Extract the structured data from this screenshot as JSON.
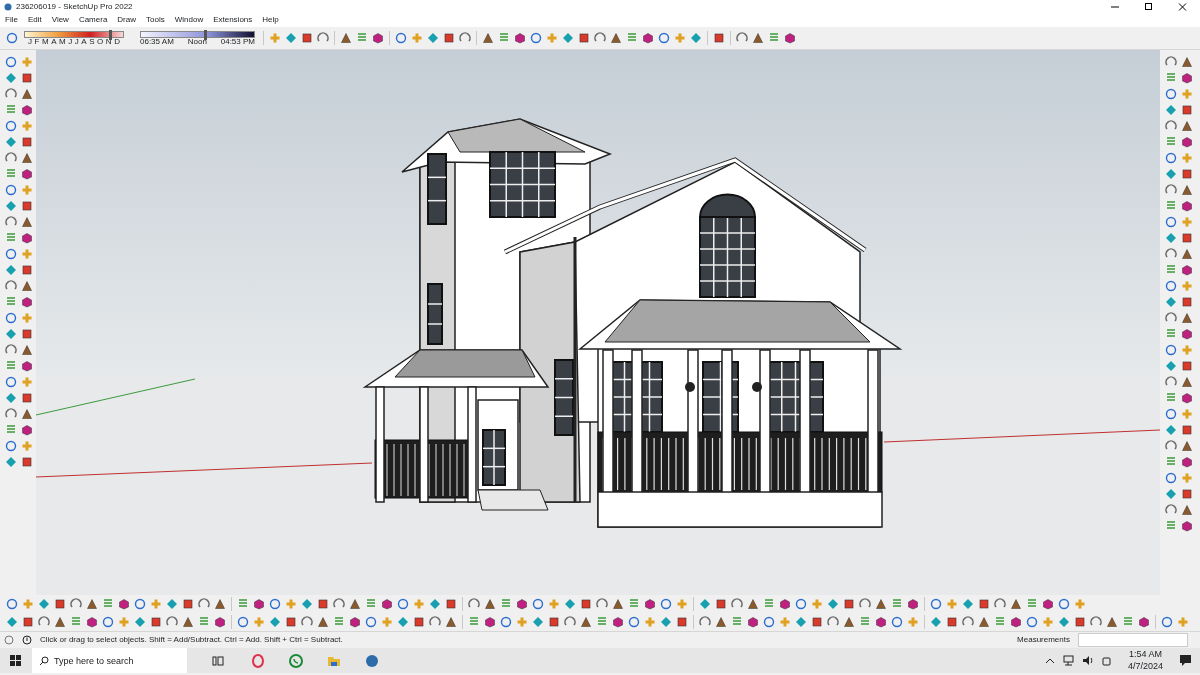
{
  "window": {
    "title": "236206019 - SketchUp Pro 2022"
  },
  "menu": [
    "File",
    "Edit",
    "View",
    "Camera",
    "Draw",
    "Tools",
    "Window",
    "Extensions",
    "Help"
  ],
  "shadow_settings": {
    "months": [
      "J",
      "F",
      "M",
      "A",
      "M",
      "J",
      "J",
      "A",
      "S",
      "O",
      "N",
      "D"
    ],
    "month_slider": {
      "level": 0.86
    },
    "times": [
      "06:35 AM",
      "Noon",
      "04:53 PM"
    ],
    "time_slider": {
      "level": 0.56
    }
  },
  "status_bar": {
    "hint": "Click or drag to select objects. Shift = Add/Subtract. Ctrl = Add. Shift + Ctrl = Subtract.",
    "measurements_label": "Measurements"
  },
  "taskbar": {
    "search_placeholder": "Type here to search",
    "time": "1:54 AM",
    "date": "4/7/2024"
  }
}
